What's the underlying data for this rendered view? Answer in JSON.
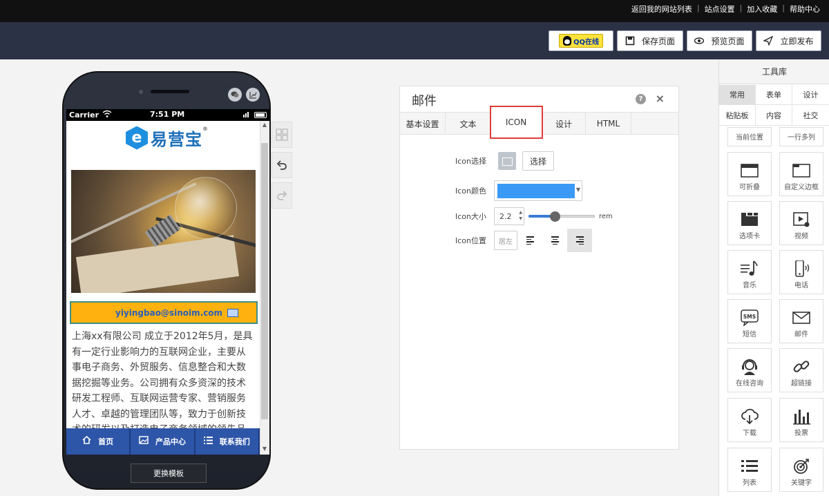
{
  "top_links": [
    "返回我的网站列表",
    "站点设置",
    "加入收藏",
    "帮助中心"
  ],
  "toolbar": {
    "qq_label": "QQ在线",
    "save_label": "保存页面",
    "preview_label": "预览页面",
    "publish_label": "立即发布"
  },
  "phone": {
    "carrier": "Carrier",
    "time": "7:51 PM",
    "logo_text": "易营宝",
    "logo_mark": "®",
    "email": "yiyingbao@sinoim.com",
    "body_text": "上海xx有限公司 成立于2012年5月，是具有一定行业影响力的互联网企业，主要从事电子商务、外贸服务、信息整合和大数据挖掘等业务。公司拥有众多资深的技术研发工程师、互联网运营专家、营销服务人才、卓越的管理团队等，致力于创新技术的研发以及打造电子商务领域的领先品",
    "nav": [
      {
        "label": "首页",
        "icon": "home-icon"
      },
      {
        "label": "产品中心",
        "icon": "picture-icon"
      },
      {
        "label": "联系我们",
        "icon": "list-icon"
      }
    ],
    "swap_template": "更换模板"
  },
  "panel": {
    "title": "邮件",
    "tabs": [
      "基本设置",
      "文本",
      "ICON",
      "设计",
      "HTML"
    ],
    "active_tab": "ICON",
    "icon_select_label": "Icon选择",
    "select_button": "选择",
    "icon_color_label": "Icon颜色",
    "icon_color": "#3a9af5",
    "icon_size_label": "Icon大小",
    "icon_size_value": "2.2",
    "icon_size_slider_fraction": 0.4,
    "icon_size_unit": "rem",
    "icon_position_label": "Icon位置",
    "icon_position_placeholder": "居左",
    "selected_alignment": "right"
  },
  "library": {
    "title": "工具库",
    "categories": [
      "常用",
      "表单",
      "设计",
      "粘贴板",
      "内容",
      "社交"
    ],
    "active_category": "常用",
    "tools": [
      {
        "label": "当前位置",
        "icon": "location-icon"
      },
      {
        "label": "一行多列",
        "icon": "columns-icon"
      },
      {
        "label": "可折叠",
        "icon": "collapse-icon"
      },
      {
        "label": "自定义边框",
        "icon": "border-icon"
      },
      {
        "label": "选项卡",
        "icon": "tabs-icon"
      },
      {
        "label": "视频",
        "icon": "video-icon"
      },
      {
        "label": "音乐",
        "icon": "music-icon"
      },
      {
        "label": "电话",
        "icon": "phone-icon"
      },
      {
        "label": "短信",
        "icon": "sms-icon"
      },
      {
        "label": "邮件",
        "icon": "mail-icon"
      },
      {
        "label": "在线咨询",
        "icon": "support-icon"
      },
      {
        "label": "超链接",
        "icon": "link-icon"
      },
      {
        "label": "下载",
        "icon": "download-icon"
      },
      {
        "label": "投票",
        "icon": "vote-icon"
      },
      {
        "label": "列表",
        "icon": "list-icon"
      },
      {
        "label": "关键字",
        "icon": "keyword-icon"
      }
    ],
    "sms_glyph": "SMS"
  },
  "colors": {
    "toolbar_bg": "#2c3246",
    "mail_bar": "#ffb20f",
    "nav_blue": "#2d55a8",
    "tab_highlight": "#e03a3a"
  }
}
